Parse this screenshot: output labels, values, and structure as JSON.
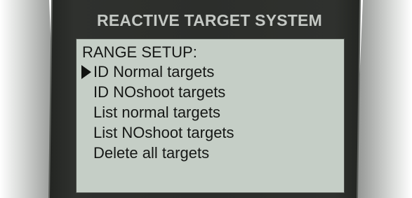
{
  "device": {
    "title": "REACTIVE TARGET SYSTEM"
  },
  "screen": {
    "heading": "RANGE SETUP:",
    "selected_index": 0,
    "items": [
      {
        "label": "ID Normal targets"
      },
      {
        "label": "ID NOshoot targets"
      },
      {
        "label": "List normal targets"
      },
      {
        "label": "List NOshoot targets"
      },
      {
        "label": "Delete all targets"
      }
    ]
  },
  "colors": {
    "bezel": "#2b2d2a",
    "lcd_background": "#c5cec6",
    "lcd_text": "#161816",
    "title_text": "#c4c8c4"
  },
  "icons": {
    "selection_cursor": "triangle-right-icon"
  }
}
